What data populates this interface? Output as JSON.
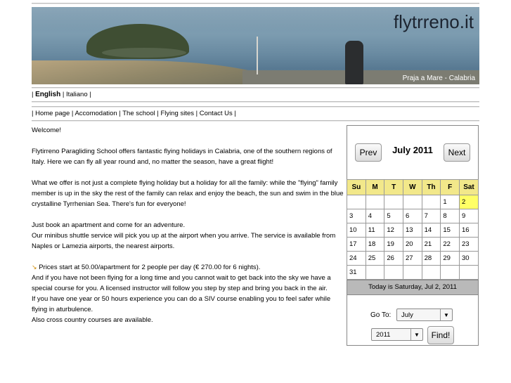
{
  "banner": {
    "site_title": "flytrreno.it",
    "caption": "Praja a Mare - Calabria"
  },
  "languages": {
    "english": "English",
    "italiano": "Italiano"
  },
  "nav": [
    "Home page",
    "Accomodation",
    "The school",
    "Flying sites",
    "Contact Us"
  ],
  "content": {
    "welcome": "Welcome!",
    "p1": "Flytirreno Paragliding School offers fantastic flying holidays in Calabria, one of the southern regions of Italy. Here we can fly all year round and, no matter the season, have a great flight!",
    "p2": "What we offer is not just a complete flying holiday but a holiday for all the family: while the \"flying\" family member is up in the sky the rest of the family can relax and enjoy the beach, the sun and swim in the blue crystalline Tyrrhenian Sea. There's fun for everyone!",
    "p3a": "Just book an apartment and come for an adventure.",
    "p3b": "Our minibus shuttle service will pick you up at the airport when you arrive. The service is available from Naples or Lamezia airports, the nearest airports.",
    "p4a": "Prices start at 50.00/apartment for 2 people per day (€ 270.00 for 6 nights).",
    "p4b": "And if you have not been flying for a long time and you cannot wait to get back into the sky we have a special course for you. A licensed instructor will follow you step by step and bring you back in the air.",
    "p4c": "If you have one year or 50 hours experience you can do a SIV course enabling you to feel safer while flying in aturbulence.",
    "p4d": "Also cross country courses are available."
  },
  "calendar": {
    "prev": "Prev",
    "next": "Next",
    "month_label": "July 2011",
    "days": [
      "Su",
      "M",
      "T",
      "W",
      "Th",
      "F",
      "Sat"
    ],
    "weeks": [
      [
        "",
        "",
        "",
        "",
        "",
        "1",
        "2"
      ],
      [
        "3",
        "4",
        "5",
        "6",
        "7",
        "8",
        "9"
      ],
      [
        "10",
        "11",
        "12",
        "13",
        "14",
        "15",
        "16"
      ],
      [
        "17",
        "18",
        "19",
        "20",
        "21",
        "22",
        "23"
      ],
      [
        "24",
        "25",
        "26",
        "27",
        "28",
        "29",
        "30"
      ],
      [
        "31",
        "",
        "",
        "",
        "",
        "",
        ""
      ]
    ],
    "today_text": "Today is Saturday, Jul 2, 2011",
    "goto_label": "Go To:",
    "month_select": "July",
    "year_select": "2011",
    "find": "Find!",
    "today_highlight": "#ffff66",
    "header_color": "#f2e88a"
  }
}
